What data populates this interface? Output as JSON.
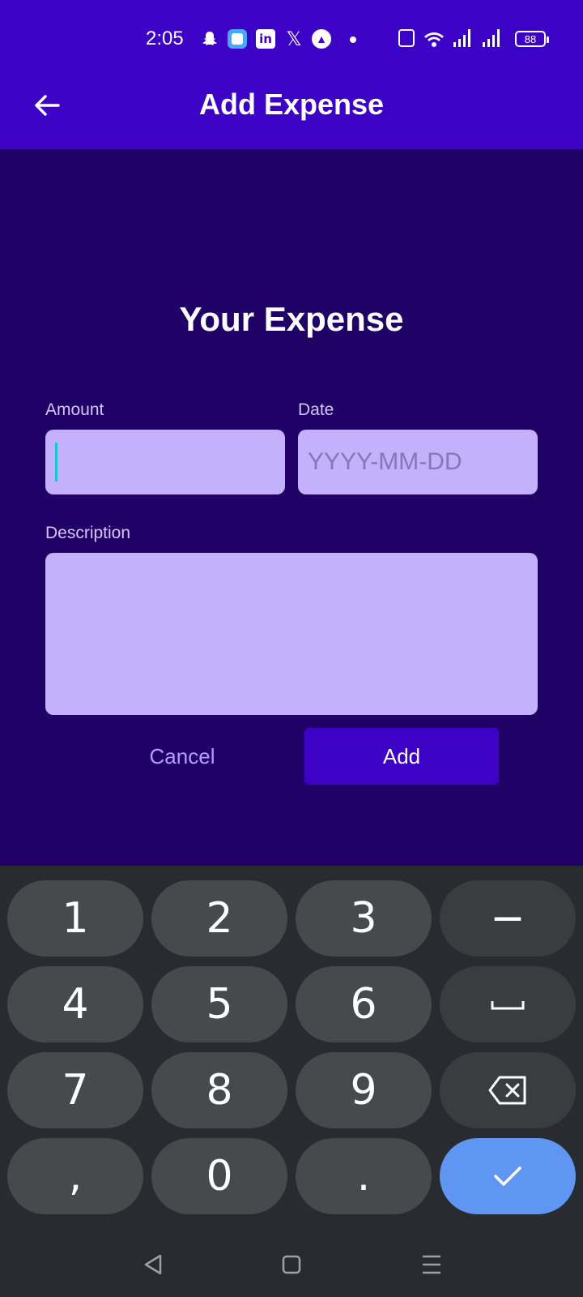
{
  "status_bar": {
    "time": "2:05",
    "battery": "88",
    "icons": [
      "snapchat-icon",
      "app-icon",
      "linkedin-icon",
      "x-icon",
      "circle-app-icon",
      "dot-icon",
      "vibrate-icon",
      "wifi-icon",
      "signal-icon",
      "signal-icon",
      "battery-icon"
    ]
  },
  "app_bar": {
    "title": "Add Expense",
    "back_icon": "arrow-left-icon"
  },
  "form": {
    "heading": "Your Expense",
    "amount_label": "Amount",
    "amount_value": "",
    "date_label": "Date",
    "date_placeholder": "YYYY-MM-DD",
    "description_label": "Description",
    "description_value": "",
    "cancel_label": "Cancel",
    "add_label": "Add"
  },
  "keyboard": {
    "rows": [
      [
        "1",
        "2",
        "3",
        "−"
      ],
      [
        "4",
        "5",
        "6",
        "space"
      ],
      [
        "7",
        "8",
        "9",
        "backspace"
      ],
      [
        ",",
        "0",
        ".",
        "done"
      ]
    ],
    "k1": "1",
    "k2": "2",
    "k3": "3",
    "minus": "−",
    "k4": "4",
    "k5": "5",
    "k6": "6",
    "k7": "7",
    "k8": "8",
    "k9": "9",
    "comma": ",",
    "k0": "0",
    "period": "."
  },
  "colors": {
    "app_bar": "#3c02c6",
    "background": "#200266",
    "field": "#c5b1fb",
    "primary_button": "#3c02c6",
    "keyboard_bg": "#282c30",
    "key": "#464a4d",
    "done_key": "#5f96f2"
  }
}
